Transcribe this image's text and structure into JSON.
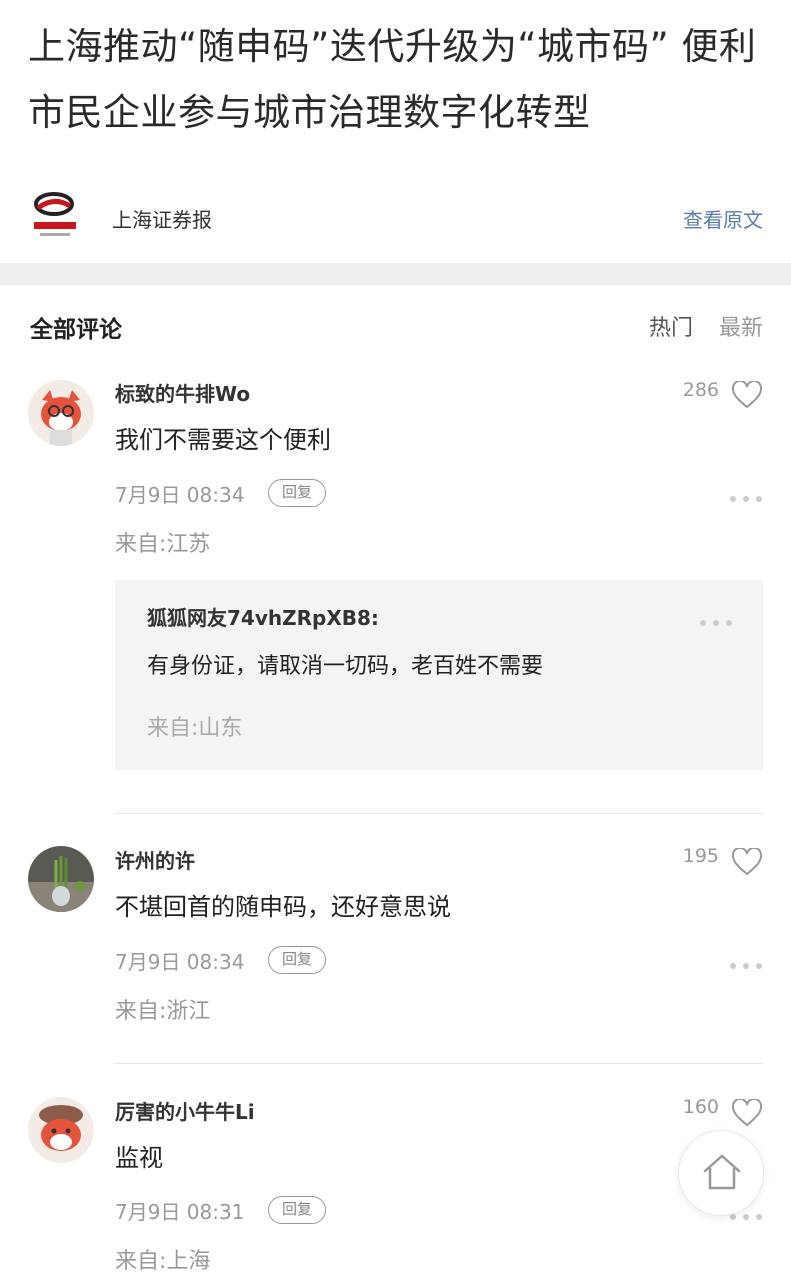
{
  "article": {
    "title": "上海推动“随申码”迭代升级为“城市码” 便利市民企业参与城市治理数字化转型",
    "source": "上海证券报",
    "view_original": "查看原文"
  },
  "comments_section": {
    "title": "全部评论",
    "sort_hot": "热门",
    "sort_new": "最新",
    "reply_label": "回复"
  },
  "comments": [
    {
      "username": "标致的牛排Wo",
      "likes": "286",
      "text": "我们不需要这个便利",
      "time": "7月9日 08:34",
      "location": "来自:江苏",
      "reply": {
        "username": "狐狐网友74vhZRpXB8:",
        "text": "有身份证，请取消一切码，老百姓不需要",
        "location": "来自:山东"
      }
    },
    {
      "username": "许州的许",
      "likes": "195",
      "text": "不堪回首的随申码，还好意思说",
      "time": "7月9日 08:34",
      "location": "来自:浙江"
    },
    {
      "username": "厉害的小牛牛Li",
      "likes": "160",
      "text": "监视",
      "time": "7月9日 08:31",
      "location": "来自:上海"
    }
  ],
  "colors": {
    "link": "#5b7dab",
    "muted": "#999999",
    "separator_bar": "#eeeeee"
  }
}
